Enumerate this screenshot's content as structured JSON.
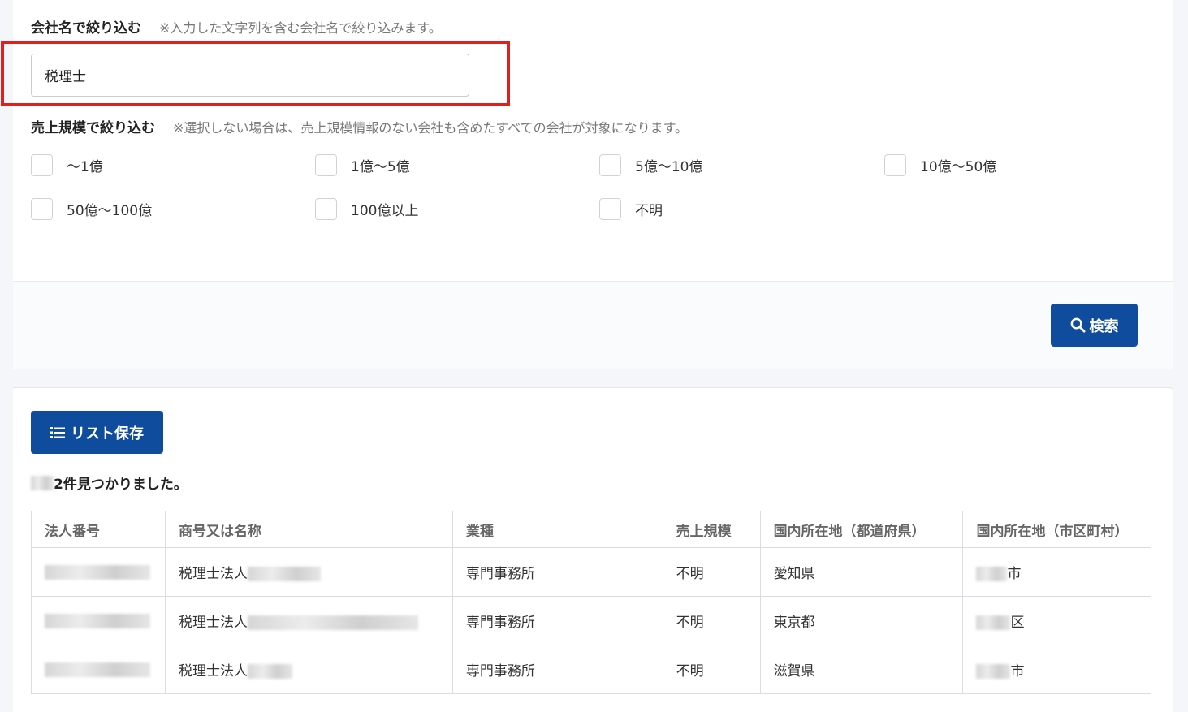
{
  "filters": {
    "company_name": {
      "title": "会社名で絞り込む",
      "note": "※入力した文字列を含む会社名で絞り込みます。",
      "value": "税理士"
    },
    "sales_scale": {
      "title": "売上規模で絞り込む",
      "note": "※選択しない場合は、売上規模情報のない会社も含めたすべての会社が対象になります。",
      "options": [
        "〜1億",
        "1億〜5億",
        "5億〜10億",
        "10億〜50億",
        "50億〜100億",
        "100億以上",
        "不明"
      ]
    }
  },
  "search_button": {
    "label": "検索",
    "icon": "search-icon"
  },
  "results": {
    "save_list_label": "リスト保存",
    "save_list_icon": "list-icon",
    "count_suffix": "2件見つかりました。",
    "columns": [
      "法人番号",
      "商号又は名称",
      "業種",
      "売上規模",
      "国内所在地（都道府県）",
      "国内所在地（市区町村）"
    ],
    "rows": [
      {
        "corp_no": "",
        "name": "税理士法人",
        "industry": "専門事務所",
        "sales": "不明",
        "prefecture": "愛知県",
        "city": "市"
      },
      {
        "corp_no": "",
        "name": "税理士法人",
        "industry": "専門事務所",
        "sales": "不明",
        "prefecture": "東京都",
        "city": "区"
      },
      {
        "corp_no": "",
        "name": "税理士法人",
        "industry": "専門事務所",
        "sales": "不明",
        "prefecture": "滋賀県",
        "city": "市"
      }
    ]
  },
  "colors": {
    "primary": "#0f4c9e",
    "highlight": "#e0201c"
  }
}
